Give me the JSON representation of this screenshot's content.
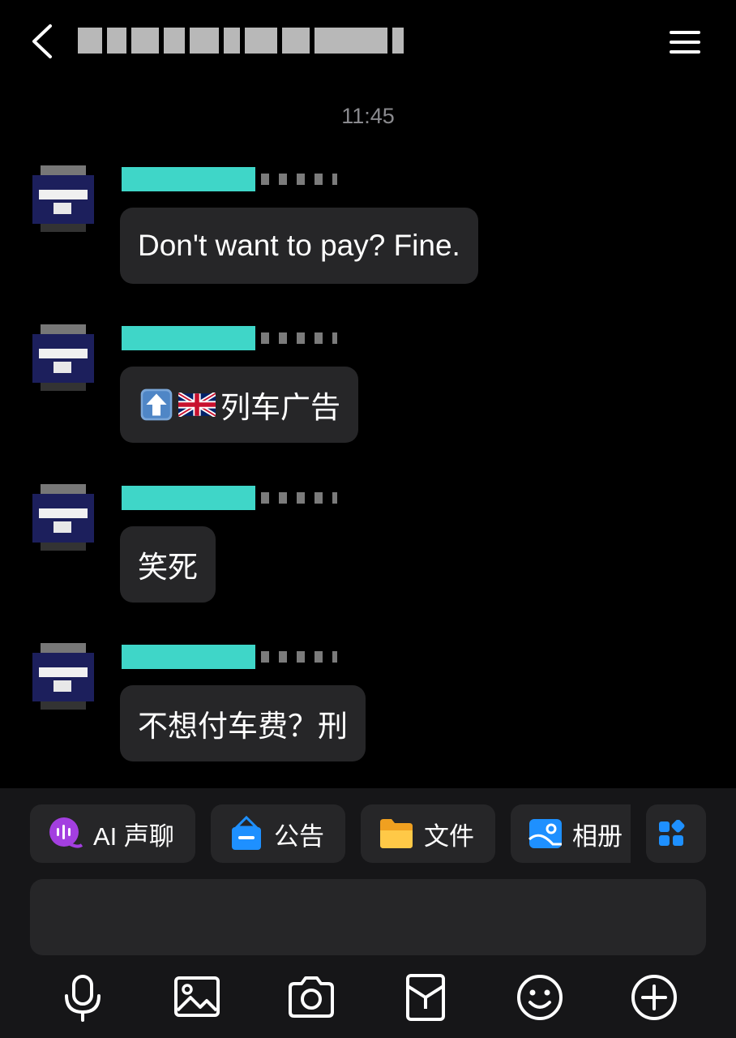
{
  "header": {
    "title": ""
  },
  "timestamp": "11:45",
  "messages": [
    {
      "text": "Don't want to pay? Fine."
    },
    {
      "text": "列车广告",
      "emojis": [
        "up-arrow",
        "uk-flag"
      ]
    },
    {
      "text": "笑死"
    },
    {
      "text": "不想付车费？刑"
    }
  ],
  "quick_actions": [
    {
      "label": "AI 声聊",
      "icon": "ai-voice-icon"
    },
    {
      "label": "公告",
      "icon": "announcement-icon"
    },
    {
      "label": "文件",
      "icon": "folder-icon"
    },
    {
      "label": "相册",
      "icon": "album-icon"
    }
  ],
  "input": {
    "placeholder": ""
  },
  "toolbar": [
    "microphone-icon",
    "image-icon",
    "camera-icon",
    "red-packet-icon",
    "emoji-icon",
    "plus-icon"
  ],
  "colors": {
    "background": "#000000",
    "bubble": "#262628",
    "name_highlight": "#3fd6c8",
    "panel": "#161618"
  }
}
